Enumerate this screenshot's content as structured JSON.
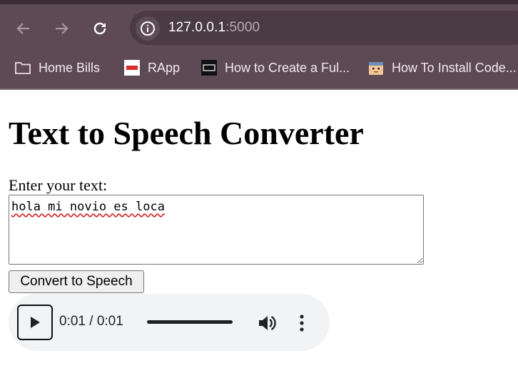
{
  "browser": {
    "url_host": "127.0.0.1",
    "url_port": ":5000",
    "bookmarks": [
      {
        "label": "Home Bills",
        "icon": "folder-icon"
      },
      {
        "label": "RApp",
        "icon": "rapp-favicon"
      },
      {
        "label": "How to Create a Ful...",
        "icon": "htg-favicon"
      },
      {
        "label": "How To Install Code...",
        "icon": "robot-favicon"
      }
    ]
  },
  "page": {
    "title": "Text to Speech Converter",
    "input_label": "Enter your text:",
    "textarea_value": "hola mi novio es loca",
    "convert_button": "Convert to Speech",
    "audio": {
      "time": "0:01 / 0:01",
      "progress": 1.0
    }
  }
}
